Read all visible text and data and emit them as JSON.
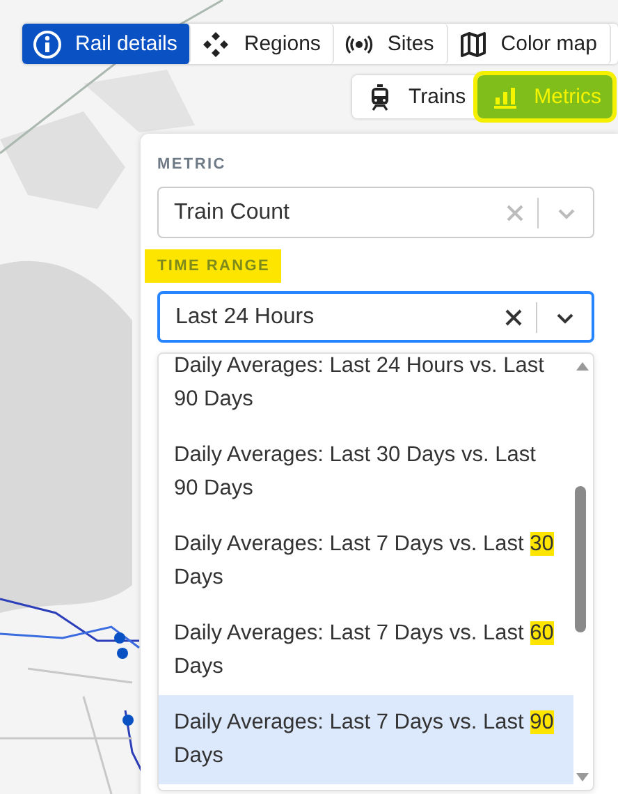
{
  "toolbar": {
    "tabs": [
      {
        "label": "Rail details",
        "selected": true
      },
      {
        "label": "Regions",
        "selected": false
      },
      {
        "label": "Sites",
        "selected": false
      },
      {
        "label": "Color map",
        "selected": false
      }
    ]
  },
  "layer_buttons": [
    {
      "label": "Trains",
      "selected": false,
      "highlighted": false
    },
    {
      "label": "Metrics",
      "selected": true,
      "highlighted": true
    }
  ],
  "panel": {
    "metric": {
      "label": "METRIC",
      "label_highlighted": false,
      "value": "Train Count",
      "focused": false
    },
    "time_range": {
      "label": "TIME RANGE",
      "label_highlighted": true,
      "value": "Last 24 Hours",
      "focused": true
    },
    "options": [
      {
        "selected": false,
        "text": "Daily Averages: Last 24 Hours vs. Last 90 Days"
      },
      {
        "selected": false,
        "text": "Daily Averages: Last 30 Days vs. Last 90 Days"
      },
      {
        "selected": false,
        "text": "Daily Averages: Last 7 Days vs. Last ",
        "highlight": "30",
        "rest": " Days"
      },
      {
        "selected": false,
        "text": "Daily Averages: Last 7 Days vs. Last ",
        "highlight": "60",
        "rest": " Days"
      },
      {
        "selected": true,
        "text": "Daily Averages: Last 7 Days vs. Last ",
        "highlight": "90",
        "rest": " Days"
      }
    ]
  }
}
